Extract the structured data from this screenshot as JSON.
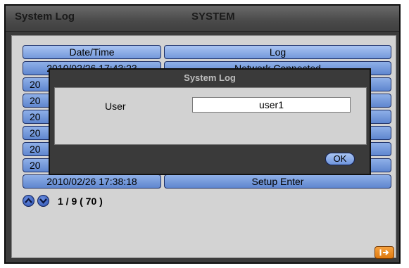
{
  "window": {
    "title": "System Log",
    "section": "SYSTEM"
  },
  "table": {
    "headers": {
      "datetime": "Date/Time",
      "log": "Log"
    },
    "rows": [
      {
        "datetime": "2010/02/26  17:43:23",
        "log": "Network Connected"
      },
      {
        "datetime": "20",
        "log": ""
      },
      {
        "datetime": "20",
        "log": ""
      },
      {
        "datetime": "20",
        "log": ""
      },
      {
        "datetime": "20",
        "log": ""
      },
      {
        "datetime": "20",
        "log": ""
      },
      {
        "datetime": "20",
        "log": ""
      },
      {
        "datetime": "2010/02/26  17:38:18",
        "log": "Setup Enter"
      }
    ]
  },
  "pagination": {
    "text": "1 / 9 ( 70 )"
  },
  "dialog": {
    "title": "System Log",
    "user_label": "User",
    "user_value": "user1",
    "ok_label": "OK"
  },
  "icons": {
    "up": "up-arrow-icon",
    "down": "down-arrow-icon",
    "exit": "exit-icon"
  },
  "colors": {
    "accent_blue": "#5f86cf",
    "exit_orange": "#e07a10"
  }
}
